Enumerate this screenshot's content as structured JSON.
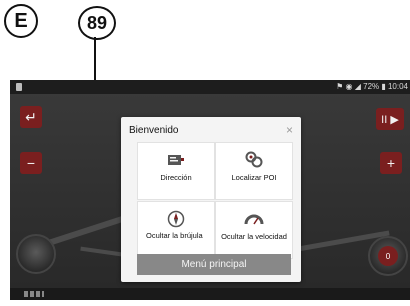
{
  "callouts": {
    "section_letter": "E",
    "item_number": "89"
  },
  "status_bar": {
    "right_text": "⚑ ◉ ◢ 72% ▮ 10:04"
  },
  "map_buttons": {
    "back": "↵",
    "zoom_out": "−",
    "next": "II ▶",
    "zoom_in": "+"
  },
  "speed_gauge_text": "0",
  "dialog": {
    "title": "Bienvenido",
    "close": "×",
    "tiles": [
      {
        "label": "Dirección",
        "icon": "address-card-icon"
      },
      {
        "label": "Localizar POI",
        "icon": "poi-pins-icon"
      },
      {
        "label": "Ocultar la brújula",
        "icon": "compass-icon"
      },
      {
        "label": "Ocultar la velocidad",
        "icon": "speedometer-icon"
      }
    ],
    "main_button": "Menú principal"
  },
  "colors": {
    "accent": "#7a1f1f",
    "dialog_bg": "#f4f4f4",
    "main_button": "#888888",
    "map_bg": "#333333"
  }
}
